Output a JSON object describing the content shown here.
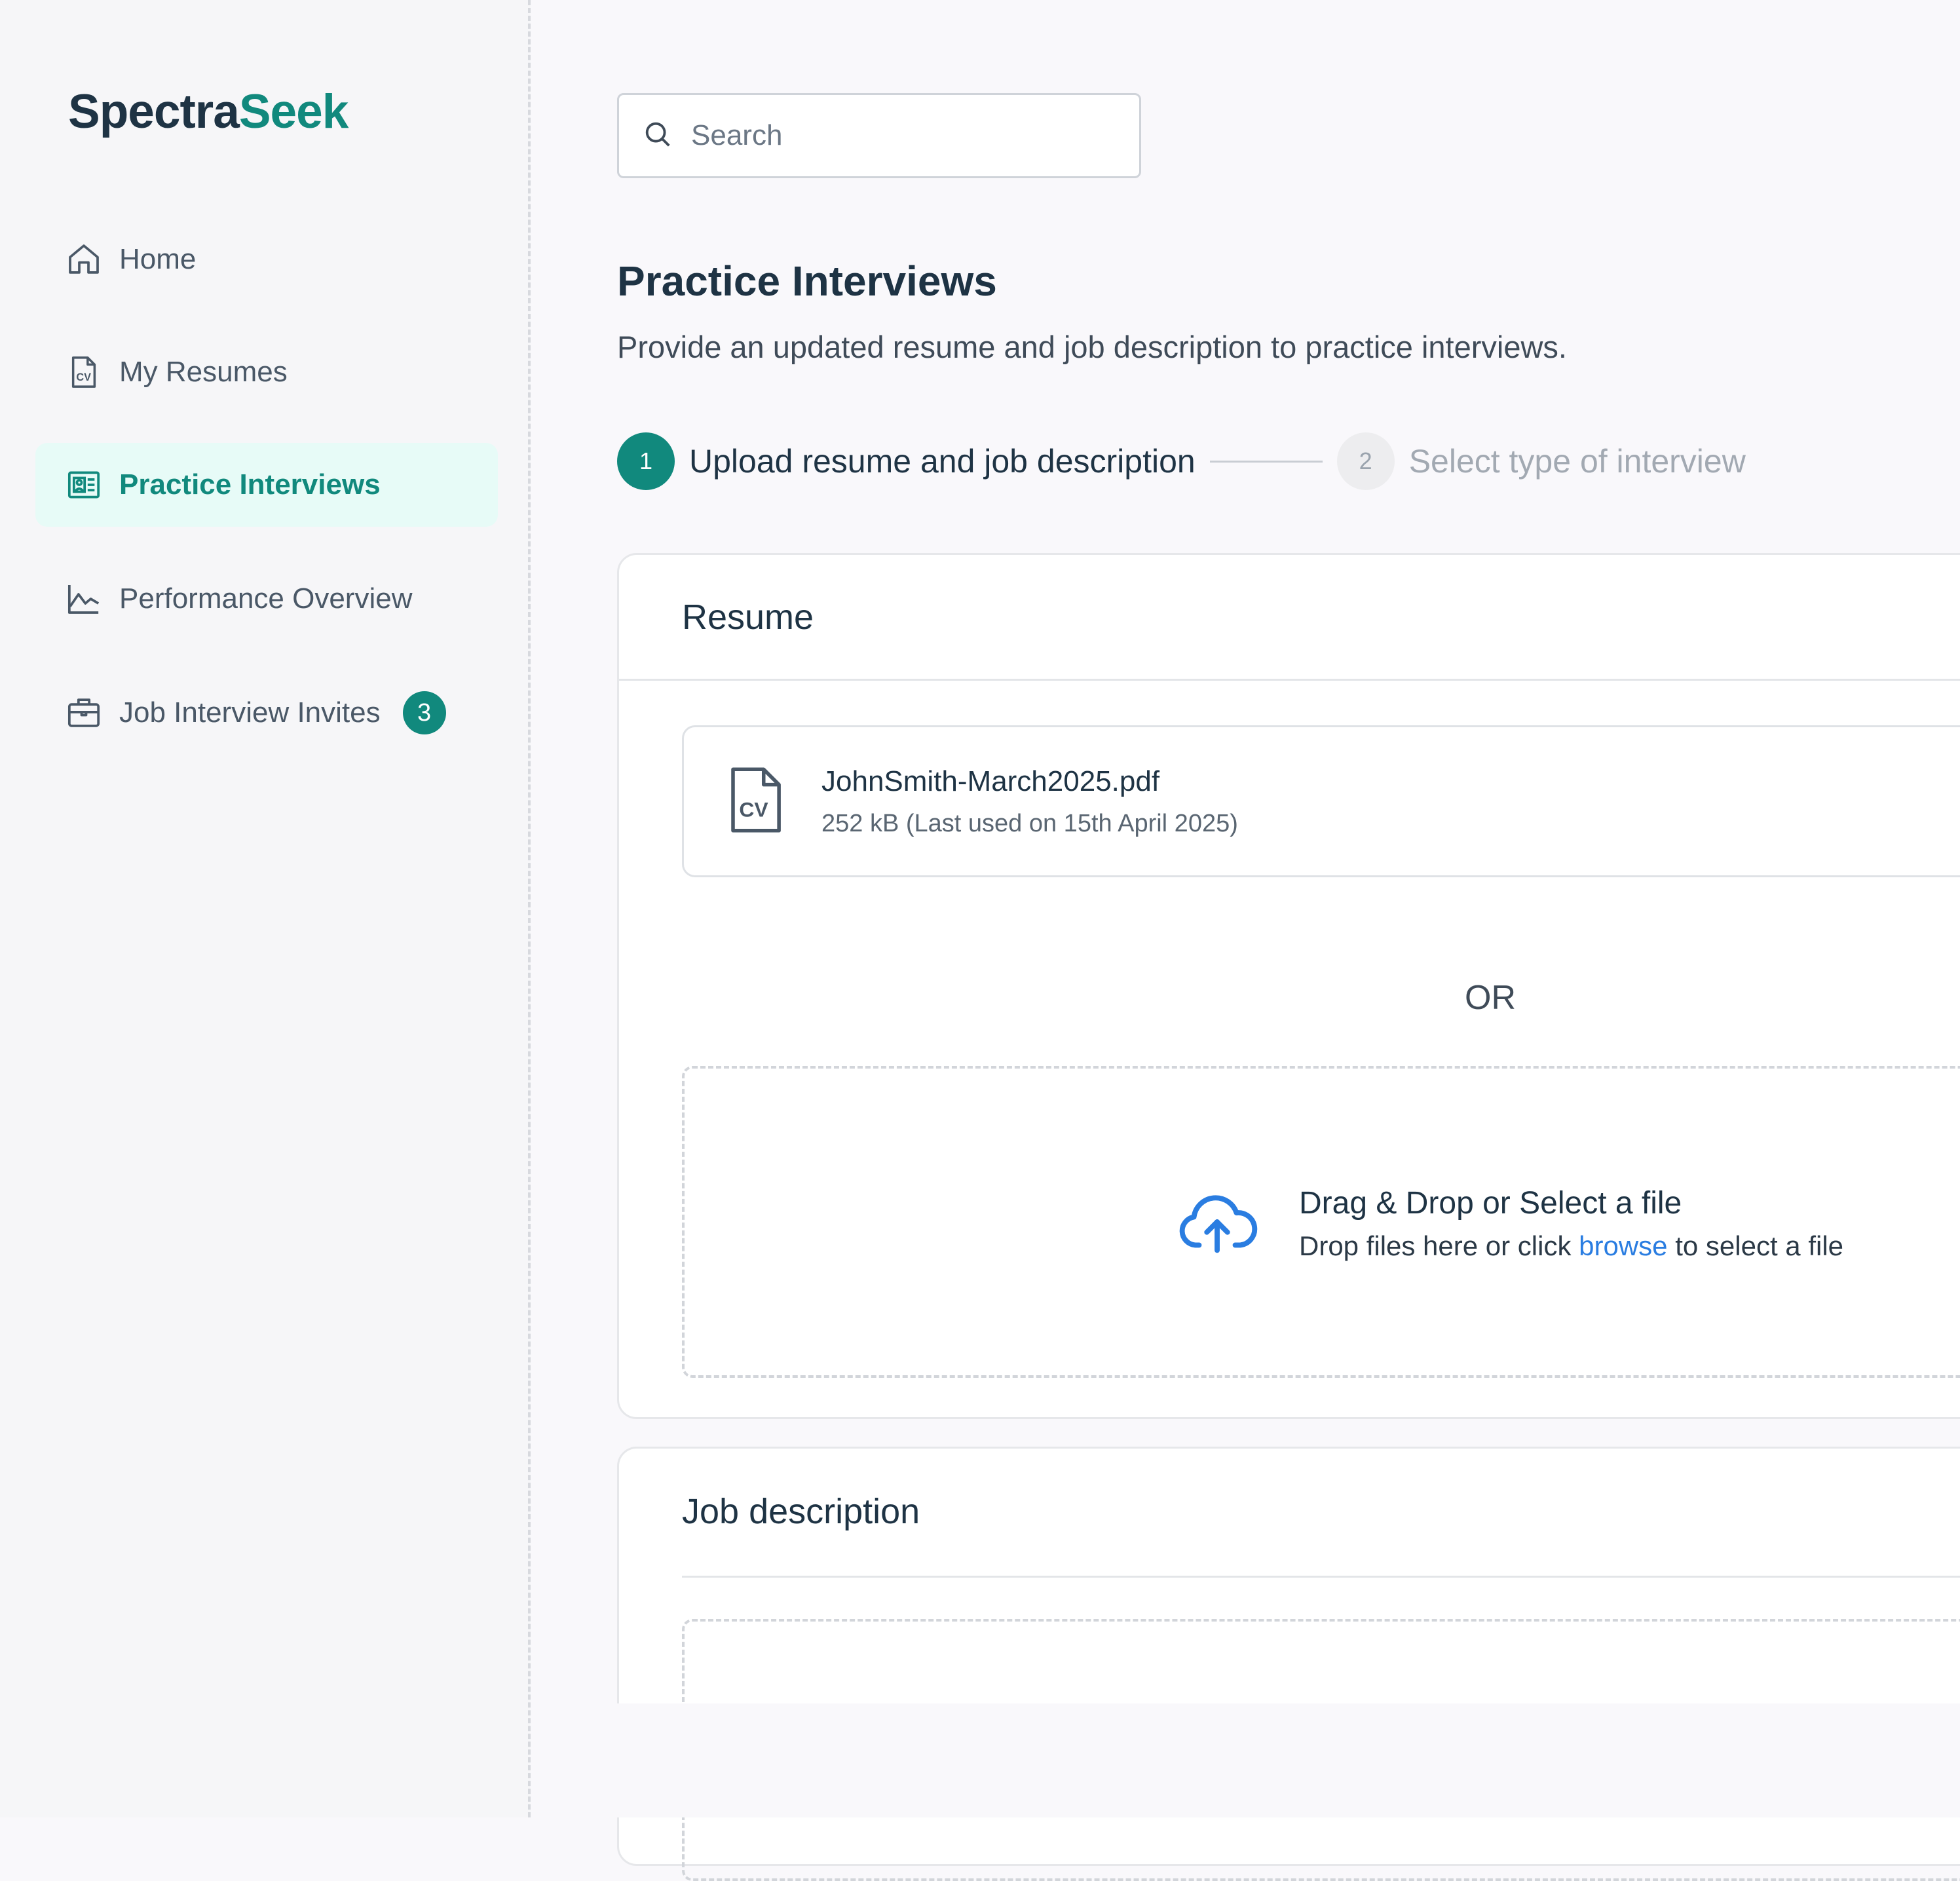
{
  "brand": {
    "part1": "Spectra",
    "part2": "Seek"
  },
  "sidebar": {
    "items": [
      {
        "label": "Home",
        "icon": "home-icon"
      },
      {
        "label": "My Resumes",
        "icon": "cv-file-icon"
      },
      {
        "label": "Practice Interviews",
        "icon": "interview-card-icon",
        "active": true
      },
      {
        "label": "Performance Overview",
        "icon": "chart-line-icon"
      },
      {
        "label": "Job Interview Invites",
        "icon": "briefcase-icon",
        "badge": "3"
      }
    ]
  },
  "search": {
    "placeholder": "Search"
  },
  "page": {
    "title": "Practice Interviews",
    "subtitle": "Provide an updated resume and job description to practice interviews."
  },
  "stepper": {
    "steps": [
      {
        "number": "1",
        "label": "Upload resume and job description",
        "state": "active"
      },
      {
        "number": "2",
        "label": "Select type of interview",
        "state": "inactive"
      }
    ]
  },
  "resume_card": {
    "title": "Resume",
    "file": {
      "name": "JohnSmith-March2025.pdf",
      "meta": "252 kB (Last used on 15th April 2025)"
    },
    "or_label": "OR",
    "dropzone": {
      "title": "Drag & Drop or Select a file",
      "sub_before": "Drop files here or click ",
      "sub_link": "browse",
      "sub_after": " to select a file"
    }
  },
  "job_card": {
    "title": "Job description"
  },
  "colors": {
    "brand_teal": "#11897d",
    "brand_dark": "#1e3344",
    "link_blue": "#2a7de1",
    "active_nav_bg": "#e7fbf7"
  }
}
